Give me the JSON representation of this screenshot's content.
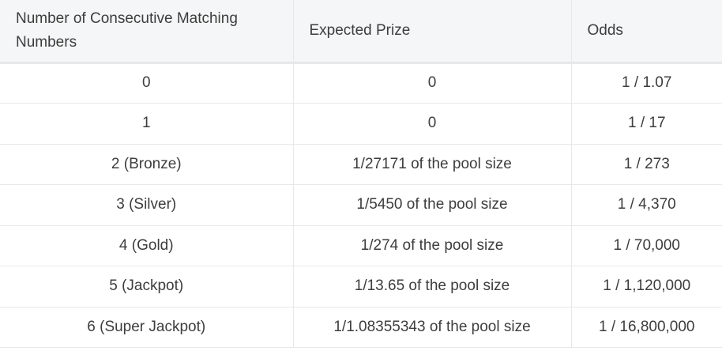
{
  "table": {
    "headers": [
      "Number of Consecutive Matching Numbers",
      "Expected Prize",
      "Odds"
    ],
    "rows": [
      [
        "0",
        "0",
        "1 / 1.07"
      ],
      [
        "1",
        "0",
        "1 / 17"
      ],
      [
        "2 (Bronze)",
        "1/27171 of the pool size",
        "1 / 273"
      ],
      [
        "3 (Silver)",
        "1/5450 of the pool size",
        "1 / 4,370"
      ],
      [
        "4 (Gold)",
        "1/274 of the pool size",
        "1 / 70,000"
      ],
      [
        "5 (Jackpot)",
        "1/13.65 of the pool size",
        "1 / 1,120,000"
      ],
      [
        "6 (Super Jackpot)",
        "1/1.08355343 of the pool size",
        "1 / 16,800,000"
      ]
    ]
  }
}
